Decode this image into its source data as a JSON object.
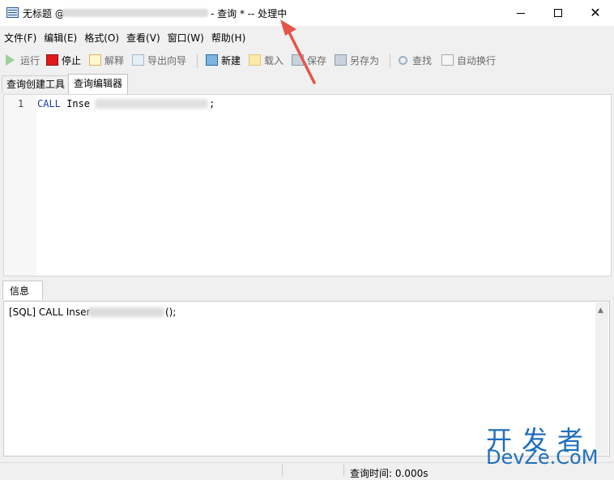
{
  "window": {
    "title_prefix": "无标题 @",
    "title_suffix": "- 查询 * -- 处理中",
    "close_glyph": "✕"
  },
  "menu": [
    "文件(F)",
    "编辑(E)",
    "格式(O)",
    "查看(V)",
    "窗口(W)",
    "帮助(H)"
  ],
  "toolbar": {
    "run": "运行",
    "stop": "停止",
    "explain": "解释",
    "export": "导出向导",
    "new": "新建",
    "load": "载入",
    "save": "保存",
    "save_as": "另存为",
    "find": "查找",
    "word_wrap": "自动换行"
  },
  "tabs": {
    "builder": "查询创建工具",
    "editor": "查询编辑器"
  },
  "editor": {
    "line_number": "1",
    "keyword": "CALL",
    "code_visible": " Inse",
    "code_tail": ";"
  },
  "info": {
    "tab_label": "信息",
    "line_visible": "[SQL] CALL Inser",
    "line_tail": "();"
  },
  "status": {
    "query_time": "查询时间: 0.000s"
  },
  "watermark": {
    "cn": "开发者",
    "en": "DevZe.CoM"
  },
  "colors": {
    "keyword": "#1c3aa9",
    "arrow": "#e8534a",
    "watermark": "#1f6fbd"
  }
}
